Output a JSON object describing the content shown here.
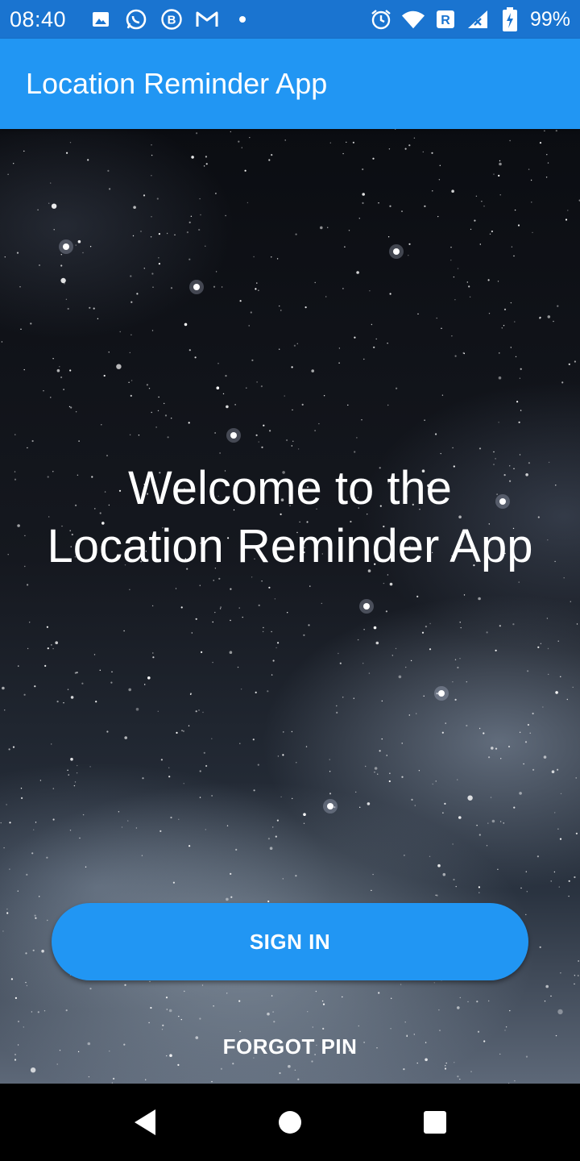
{
  "status_bar": {
    "time": "08:40",
    "left_icons": [
      "image-icon",
      "whatsapp-icon",
      "b-circle-icon",
      "gmail-icon",
      "dot-icon"
    ],
    "right_icons": [
      "alarm-icon",
      "wifi-icon",
      "roaming-signal-icon",
      "battery-charging-icon"
    ],
    "battery_text": "99%"
  },
  "app_bar": {
    "title": "Location Reminder App"
  },
  "main": {
    "welcome_line1": "Welcome to the",
    "welcome_line2": "Location Reminder App",
    "signin_label": "SIGN IN",
    "forgot_pin_label": "FORGOT PIN"
  },
  "nav_bar": {
    "buttons": [
      "back-icon",
      "home-icon",
      "recents-icon"
    ]
  },
  "colors": {
    "status_bar": "#1a74d0",
    "app_bar": "#2196f3",
    "button": "#2196f3",
    "text": "#ffffff"
  }
}
